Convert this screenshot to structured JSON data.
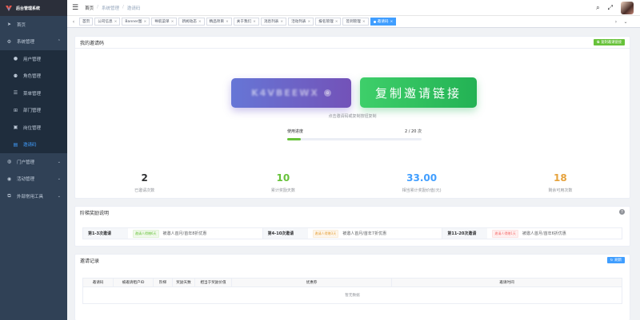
{
  "app": {
    "title": "后台管理系统"
  },
  "colors": {
    "sidebar": "#304156",
    "accent": "#409eff",
    "green": "#67c23a",
    "orange": "#e6a23c"
  },
  "sidebar": {
    "items": [
      {
        "label": "首页",
        "icon": "send-icon"
      },
      {
        "label": "系统管理",
        "icon": "gear-icon"
      },
      {
        "label": "用户管理",
        "icon": "user-icon"
      },
      {
        "label": "角色管理",
        "icon": "users-icon"
      },
      {
        "label": "菜单管理",
        "icon": "list-icon"
      },
      {
        "label": "部门管理",
        "icon": "tree-icon"
      },
      {
        "label": "岗位管理",
        "icon": "post-icon"
      },
      {
        "label": "邀请码",
        "icon": "document-icon"
      },
      {
        "label": "门户管理",
        "icon": "globe-icon"
      },
      {
        "label": "活动管理",
        "icon": "chat-icon"
      },
      {
        "label": "外部常用工具",
        "icon": "external-link-icon"
      }
    ]
  },
  "breadcrumb": {
    "home": "首页",
    "section": "系统管理",
    "current": "邀请码"
  },
  "tags": [
    "首页",
    "公司信息",
    "Banner图",
    "导航菜单",
    "新闻动态",
    "精品项目",
    "关于我们",
    "消息列表",
    "活动列表",
    "报名管理",
    "签到管理",
    "邀请码"
  ],
  "invite": {
    "title": "我的邀请码",
    "copy_link_button": "复制邀请链接",
    "copy_link_small_button": "复制邀请链接",
    "code": "K4VBEEWX",
    "hint": "点击邀请码或复制按钮复制",
    "usage_label": "使用进度",
    "usage_value": "2 / 20 次",
    "usage_fraction": 0.1
  },
  "stats": [
    {
      "value": "2",
      "label": "已邀请次数",
      "color": "#303133"
    },
    {
      "value": "10",
      "label": "累计奖励天数",
      "color": "#67c23a"
    },
    {
      "value": "33.00",
      "label": "相当累计奖励价值(元)",
      "color": "#409eff"
    },
    {
      "value": "18",
      "label": "剩余可用次数",
      "color": "#e6a23c"
    }
  ],
  "tiers": {
    "title": "阶梯奖励说明",
    "items": [
      {
        "name": "第1-3次邀请",
        "badge": "邀请人得赠6天",
        "desc": "被邀人首月/首年8折优惠",
        "style": "b-green"
      },
      {
        "name": "第4-10次邀请",
        "badge": "邀请人得赠3天",
        "desc": "被邀人首月/首年7折优惠",
        "style": "b-orange"
      },
      {
        "name": "第11-20次邀请",
        "badge": "邀请人得赠1天",
        "desc": "被邀人首月/首年6折优惠",
        "style": "b-red"
      }
    ]
  },
  "records": {
    "title": "邀请记录",
    "refresh_button": "刷新",
    "columns": [
      "邀请码",
      "被邀请租户ID",
      "阶梯",
      "奖励天数",
      "相当于奖励价值",
      "优惠券",
      "邀请时间"
    ],
    "empty_text": "暂无数据"
  }
}
